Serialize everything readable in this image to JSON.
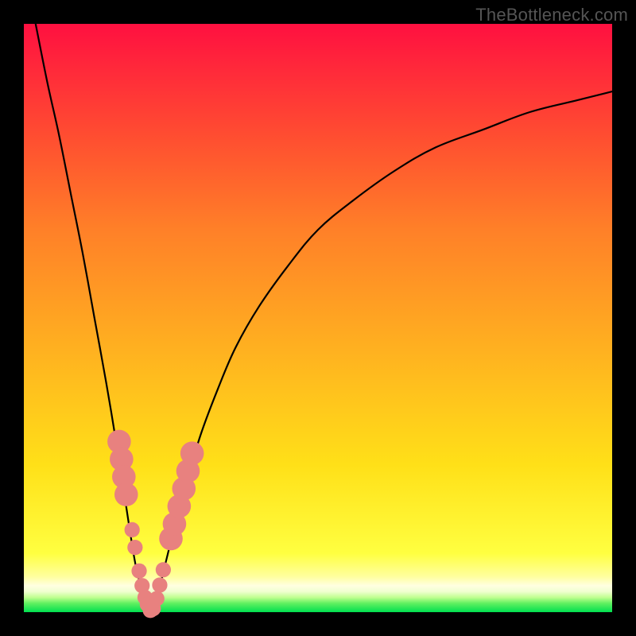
{
  "watermark": "TheBottleneck.com",
  "colors": {
    "frame_bg": "#000000",
    "gradient_top": "#ff1040",
    "gradient_bottom": "#00e050",
    "curve": "#000000",
    "marker": "#e8817f"
  },
  "chart_data": {
    "type": "line",
    "title": "",
    "xlabel": "",
    "ylabel": "",
    "xlim": [
      0,
      100
    ],
    "ylim": [
      0,
      100
    ],
    "grid": false,
    "legend": false,
    "series": [
      {
        "name": "left-branch",
        "x": [
          2,
          4,
          6,
          8,
          10,
          12,
          14,
          16,
          18,
          19,
          20,
          21,
          21.5
        ],
        "y": [
          100,
          90,
          81,
          71,
          61,
          50,
          39,
          27,
          14,
          8,
          4,
          1,
          0
        ]
      },
      {
        "name": "right-branch",
        "x": [
          21.5,
          22.5,
          24,
          26,
          28,
          30,
          33,
          36,
          40,
          45,
          50,
          56,
          63,
          70,
          78,
          86,
          94,
          100
        ],
        "y": [
          0,
          2,
          8,
          16,
          23,
          30,
          38,
          45,
          52,
          59,
          65,
          70,
          75,
          79,
          82,
          85,
          87,
          88.5
        ]
      }
    ],
    "markers": {
      "name": "highlighted-points",
      "color": "#e8817f",
      "points": [
        {
          "x": 16.2,
          "y": 29,
          "r": 2.0
        },
        {
          "x": 16.6,
          "y": 26,
          "r": 2.0
        },
        {
          "x": 17.0,
          "y": 23,
          "r": 2.0
        },
        {
          "x": 17.4,
          "y": 20,
          "r": 2.0
        },
        {
          "x": 18.4,
          "y": 14,
          "r": 1.3
        },
        {
          "x": 18.9,
          "y": 11,
          "r": 1.3
        },
        {
          "x": 19.6,
          "y": 7,
          "r": 1.3
        },
        {
          "x": 20.1,
          "y": 4.5,
          "r": 1.3
        },
        {
          "x": 20.6,
          "y": 2.5,
          "r": 1.3
        },
        {
          "x": 21.0,
          "y": 1.3,
          "r": 1.3
        },
        {
          "x": 21.5,
          "y": 0.3,
          "r": 1.3
        },
        {
          "x": 22.0,
          "y": 0.6,
          "r": 1.3
        },
        {
          "x": 22.6,
          "y": 2.3,
          "r": 1.3
        },
        {
          "x": 23.1,
          "y": 4.6,
          "r": 1.3
        },
        {
          "x": 23.7,
          "y": 7.2,
          "r": 1.3
        },
        {
          "x": 25.0,
          "y": 12.5,
          "r": 2.0
        },
        {
          "x": 25.6,
          "y": 15,
          "r": 2.0
        },
        {
          "x": 26.4,
          "y": 18,
          "r": 2.0
        },
        {
          "x": 27.2,
          "y": 21,
          "r": 2.0
        },
        {
          "x": 27.9,
          "y": 24,
          "r": 2.0
        },
        {
          "x": 28.6,
          "y": 27,
          "r": 2.0
        }
      ]
    }
  }
}
